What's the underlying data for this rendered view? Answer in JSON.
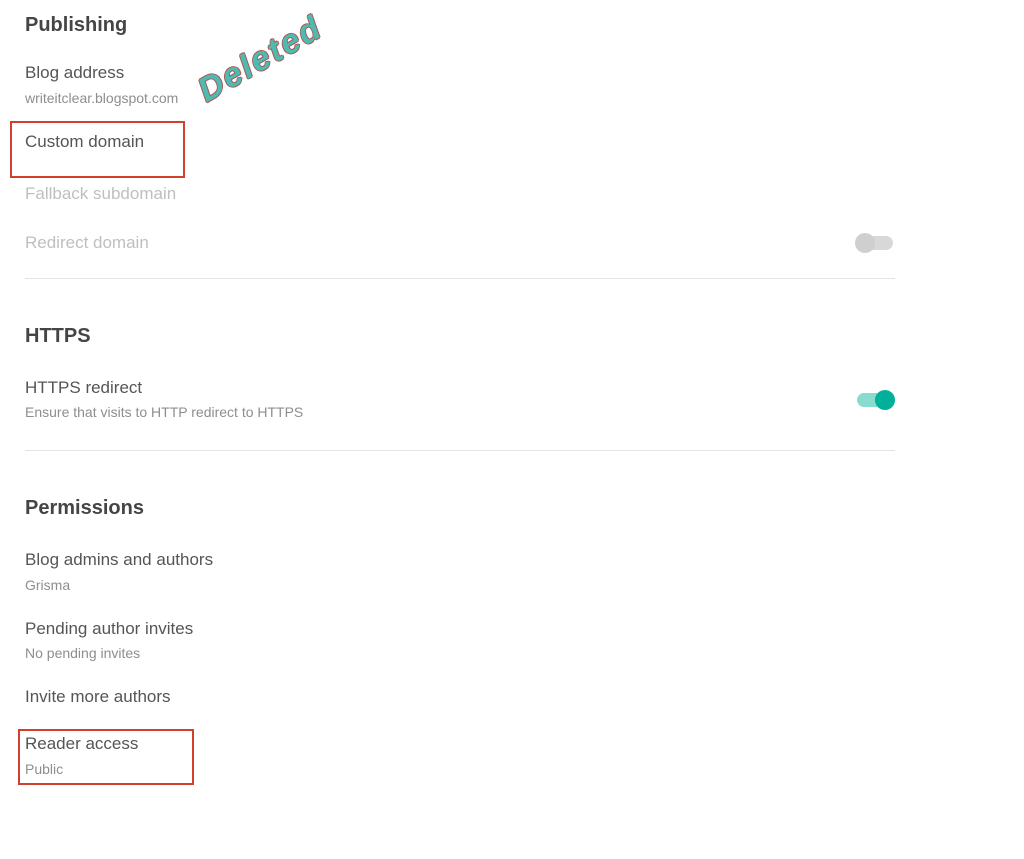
{
  "publishing": {
    "title": "Publishing",
    "blog_address": {
      "label": "Blog address",
      "value": "writeitclear.blogspot.com"
    },
    "custom_domain": {
      "label": "Custom domain"
    },
    "fallback_subdomain": {
      "label": "Fallback subdomain"
    },
    "redirect_domain": {
      "label": "Redirect domain",
      "enabled": false
    }
  },
  "https": {
    "title": "HTTPS",
    "redirect": {
      "label": "HTTPS redirect",
      "desc": "Ensure that visits to HTTP redirect to HTTPS",
      "enabled": true
    }
  },
  "permissions": {
    "title": "Permissions",
    "admins": {
      "label": "Blog admins and authors",
      "value": "Grisma"
    },
    "pending": {
      "label": "Pending author invites",
      "value": "No pending invites"
    },
    "invite_more": {
      "label": "Invite more authors"
    },
    "reader_access": {
      "label": "Reader access",
      "value": "Public"
    }
  },
  "annotation": {
    "deleted": "Deleted"
  }
}
